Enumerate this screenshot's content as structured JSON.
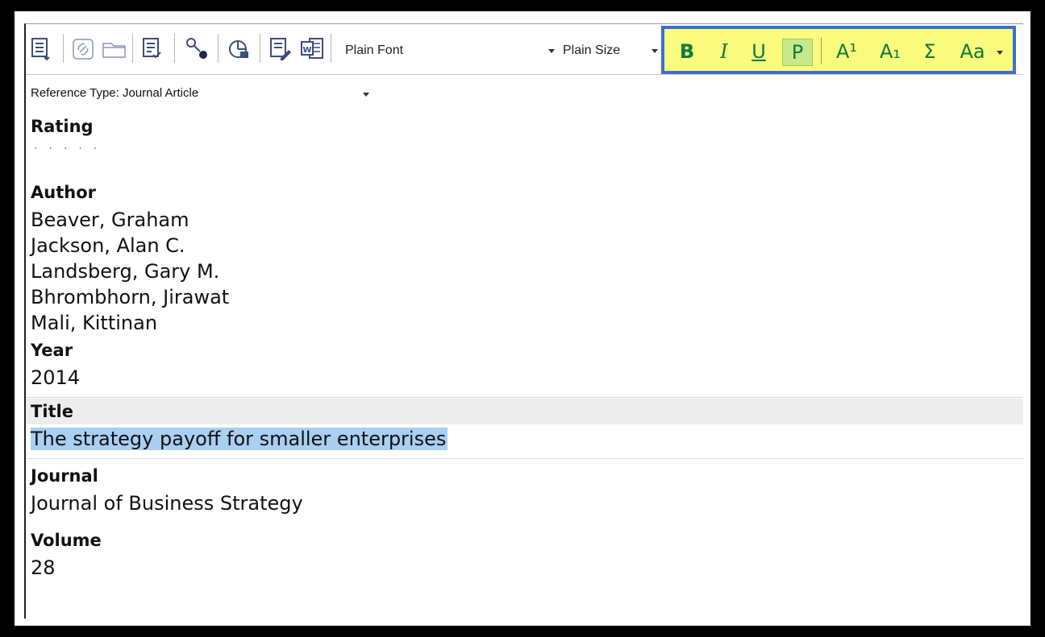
{
  "toolbar": {
    "font_select": "Plain Font",
    "size_select": "Plain Size",
    "format": {
      "bold": "B",
      "italic": "I",
      "underline": "U",
      "plain": "P",
      "superscript": "A¹",
      "subscript": "A₁",
      "symbol": "Σ",
      "case": "Aa"
    },
    "highlight_color": "#fbfb7e",
    "box_color": "#3f6fce"
  },
  "reference_type": "Reference Type:  Journal Article",
  "fields": {
    "rating_label": "Rating",
    "rating_dots": "·····",
    "author_label": "Author",
    "authors": [
      "Beaver, Graham",
      "Jackson, Alan C.",
      "Landsberg, Gary M.",
      "Bhrombhorn, Jirawat",
      "Mali, Kittinan"
    ],
    "year_label": "Year",
    "year": "2014",
    "title_label": "Title",
    "title": "The strategy payoff for smaller enterprises",
    "journal_label": "Journal",
    "journal": "Journal of Business Strategy",
    "volume_label": "Volume",
    "volume": "28"
  },
  "selection_color": "#a9cff2"
}
